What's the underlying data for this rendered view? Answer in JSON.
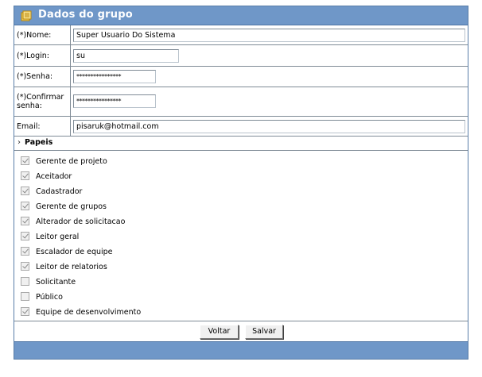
{
  "panel": {
    "title": "Dados do grupo"
  },
  "form": {
    "nome": {
      "label": "(*)Nome:",
      "value": "Super Usuario Do Sistema"
    },
    "login": {
      "label": "(*)Login:",
      "value": "su"
    },
    "senha": {
      "label": "(*)Senha:",
      "value": "****************"
    },
    "confirmar": {
      "label": "(*)Confirmar senha:",
      "value": "****************"
    },
    "email": {
      "label": "Email:",
      "value": "pisaruk@hotmail.com"
    }
  },
  "papeis": {
    "title": "Papeis",
    "items": [
      {
        "label": "Gerente de projeto",
        "checked": true
      },
      {
        "label": "Aceitador",
        "checked": true
      },
      {
        "label": "Cadastrador",
        "checked": true
      },
      {
        "label": "Gerente de grupos",
        "checked": true
      },
      {
        "label": "Alterador de solicitacao",
        "checked": true
      },
      {
        "label": "Leitor geral",
        "checked": true
      },
      {
        "label": "Escalador de equipe",
        "checked": true
      },
      {
        "label": "Leitor de relatorios",
        "checked": true
      },
      {
        "label": "Solicitante",
        "checked": false
      },
      {
        "label": "Público",
        "checked": false
      },
      {
        "label": "Equipe de desenvolvimento",
        "checked": true
      }
    ]
  },
  "buttons": {
    "voltar": "Voltar",
    "salvar": "Salvar"
  },
  "colors": {
    "header": "#6f97c8",
    "border": "#7f8b96"
  }
}
